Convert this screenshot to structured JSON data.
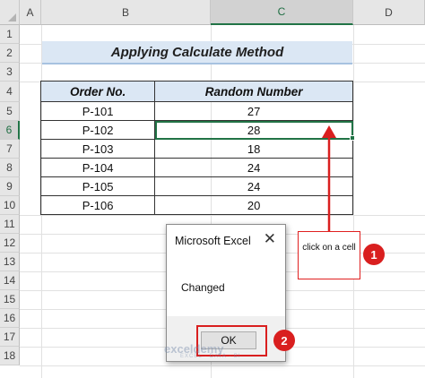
{
  "columns": [
    "A",
    "B",
    "C",
    "D"
  ],
  "rows": [
    "1",
    "2",
    "3",
    "4",
    "5",
    "6",
    "7",
    "8",
    "9",
    "10",
    "11",
    "12",
    "13",
    "14",
    "15",
    "16",
    "17",
    "18"
  ],
  "selected_column": "C",
  "selected_row": "6",
  "title": "Applying Calculate Method",
  "table": {
    "headers": [
      "Order No.",
      "Random Number"
    ],
    "rows": [
      [
        "P-101",
        "27"
      ],
      [
        "P-102",
        "28"
      ],
      [
        "P-103",
        "18"
      ],
      [
        "P-104",
        "24"
      ],
      [
        "P-105",
        "24"
      ],
      [
        "P-106",
        "20"
      ]
    ]
  },
  "callout": {
    "text": "click on a cell",
    "badge": "1"
  },
  "dialog": {
    "title": "Microsoft Excel",
    "message": "Changed",
    "ok_label": "OK",
    "badge": "2"
  },
  "watermark": {
    "brand": "exceldemy",
    "tagline": "EXCEL · DATA · BI"
  },
  "colors": {
    "accent_red": "#d91f1f",
    "excel_green": "#217346",
    "header_fill": "#dbe7f4"
  }
}
